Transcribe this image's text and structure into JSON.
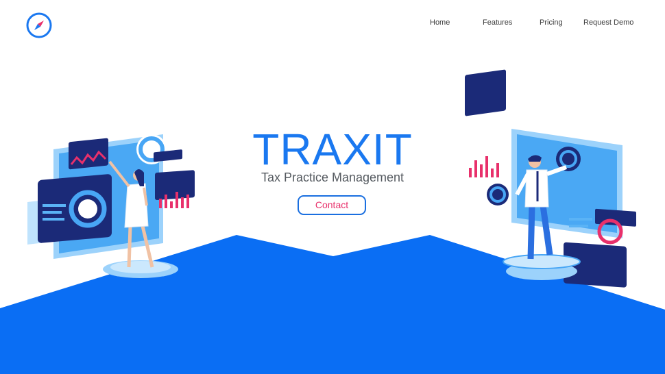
{
  "brand": {
    "logo_icon": "compass-icon",
    "accent": "#1a78f0",
    "highlight": "#e8306b"
  },
  "nav": {
    "items": [
      {
        "label": "Home"
      },
      {
        "label": "Features"
      },
      {
        "label": "Pricing"
      },
      {
        "label": "Request Demo"
      }
    ]
  },
  "hero": {
    "title": "TRAXIT",
    "subtitle": "Tax Practice Management",
    "cta_label": "Contact"
  },
  "colors": {
    "floor": "#0a6ef4",
    "panel": "#48a6f5",
    "panel_dark": "#1b2a78",
    "pink": "#e8306b"
  }
}
